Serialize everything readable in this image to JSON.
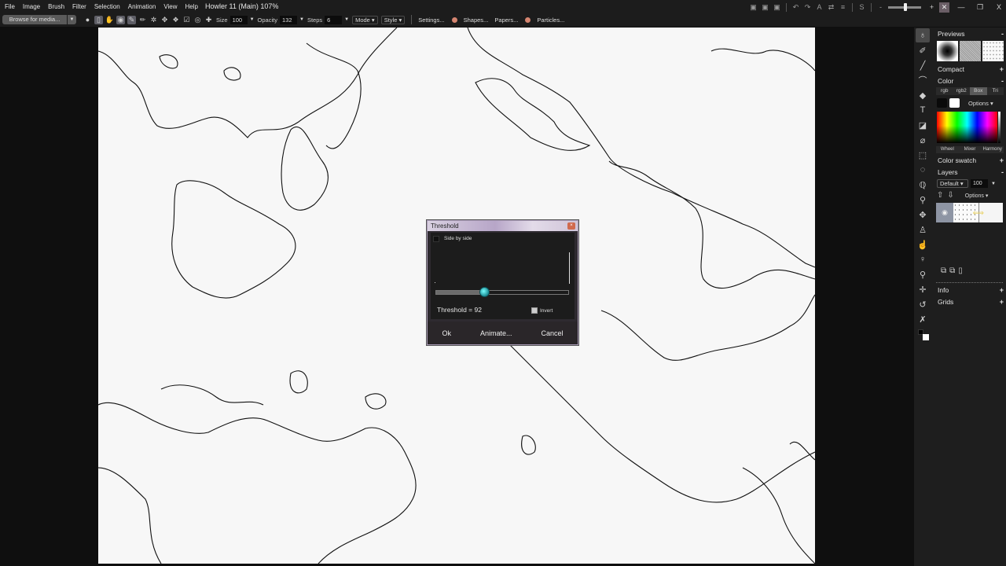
{
  "app": {
    "title": "Howler 11  (Main)   107%"
  },
  "menu": [
    "File",
    "Image",
    "Brush",
    "Filter",
    "Selection",
    "Animation",
    "View",
    "Help"
  ],
  "toolbar": {
    "browse_label": "Browse for media...",
    "brush_icons": [
      "dot-brush-icon",
      "lamp-brush-icon",
      "hand-icon",
      "eye-icon",
      "pen-tablet-icon",
      "pencil-icon",
      "cycle-icon",
      "move-icon",
      "stamp-icon",
      "edit-icon",
      "circle-icon",
      "cross-icon"
    ],
    "size_label": "Size",
    "size_value": "100",
    "opacity_label": "Opacity",
    "opacity_value": "132",
    "steps_label": "Steps",
    "steps_value": "6",
    "mode_label": "Mode",
    "style_label": "Style",
    "settings_label": "Settings...",
    "shapes_label": "Shapes...",
    "papers_label": "Papers...",
    "particles_label": "Particles..."
  },
  "window_controls": {
    "zoom_minus": "-",
    "zoom_plus": "+",
    "minimize": "—",
    "restore": "❐",
    "close": "X",
    "zoom_level": 0.5
  },
  "tools": [
    "brush-tool-icon",
    "smudge-tool-icon",
    "line-tool-icon",
    "curve-tool-icon",
    "fill-tool-icon",
    "text-tool-icon",
    "crop-tool-icon",
    "eraser-shape-icon",
    "rect-select-icon",
    "ellipse-select-icon",
    "lasso-icon",
    "pin-icon",
    "transform-icon",
    "clone-icon",
    "hand-tool-icon",
    "magnify-icon",
    "zoom-100-icon",
    "crosshair-icon",
    "undo-icon",
    "pushpin-icon"
  ],
  "panels": {
    "previews": {
      "label": "Previews",
      "toggle": "-"
    },
    "compact": {
      "label": "Compact",
      "toggle": "+"
    },
    "color": {
      "label": "Color",
      "toggle": "-",
      "tabs": [
        "rgb",
        "rgb2",
        "Box",
        "Tri"
      ],
      "active_tab": "Box",
      "primary": "#0a0a0a",
      "secondary": "#ffffff",
      "options_label": "Options",
      "mode_tabs": [
        "Wheel",
        "Mixer",
        "Harmony"
      ]
    },
    "color_swatch": {
      "label": "Color swatch",
      "toggle": "+"
    },
    "layers": {
      "label": "Layers",
      "toggle": "-",
      "blend_mode": "Default",
      "opacity": "100",
      "options_label": "Options"
    },
    "info": {
      "label": "Info",
      "toggle": "+"
    },
    "grids": {
      "label": "Grids",
      "toggle": "+"
    }
  },
  "dialog": {
    "title": "Threshold",
    "side_by_side_label": "Side by side",
    "threshold_text": "Threshold = 92",
    "threshold_value": 92,
    "threshold_max": 255,
    "invert_label": "Invert",
    "ok_label": "Ok",
    "animate_label": "Animate...",
    "cancel_label": "Cancel"
  }
}
